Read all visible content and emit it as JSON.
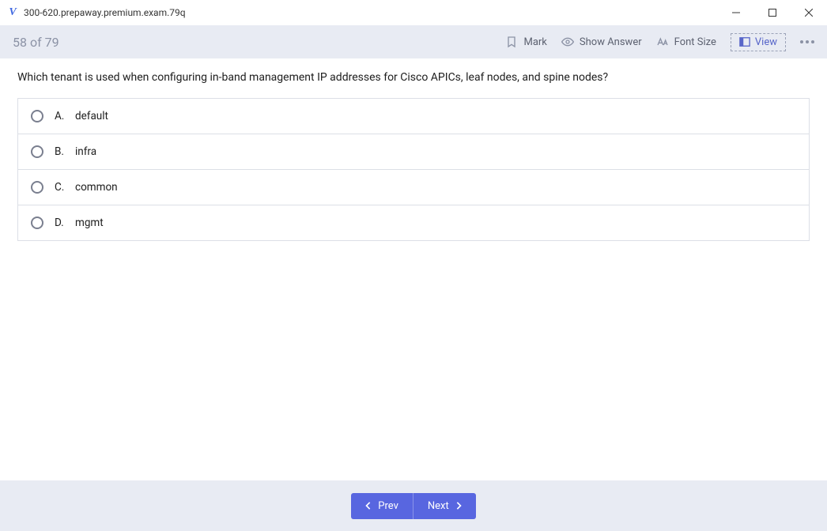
{
  "window": {
    "title": "300-620.prepaway.premium.exam.79q"
  },
  "toolbar": {
    "progress": "58 of 79",
    "mark_label": "Mark",
    "show_answer_label": "Show Answer",
    "font_size_label": "Font Size",
    "view_label": "View"
  },
  "question": {
    "text": "Which tenant is used when configuring in-band management IP addresses for Cisco APICs, leaf nodes, and spine nodes?",
    "answers": [
      {
        "letter": "A.",
        "text": "default"
      },
      {
        "letter": "B.",
        "text": "infra"
      },
      {
        "letter": "C.",
        "text": "common"
      },
      {
        "letter": "D.",
        "text": "mgmt"
      }
    ]
  },
  "footer": {
    "prev_label": "Prev",
    "next_label": "Next"
  }
}
